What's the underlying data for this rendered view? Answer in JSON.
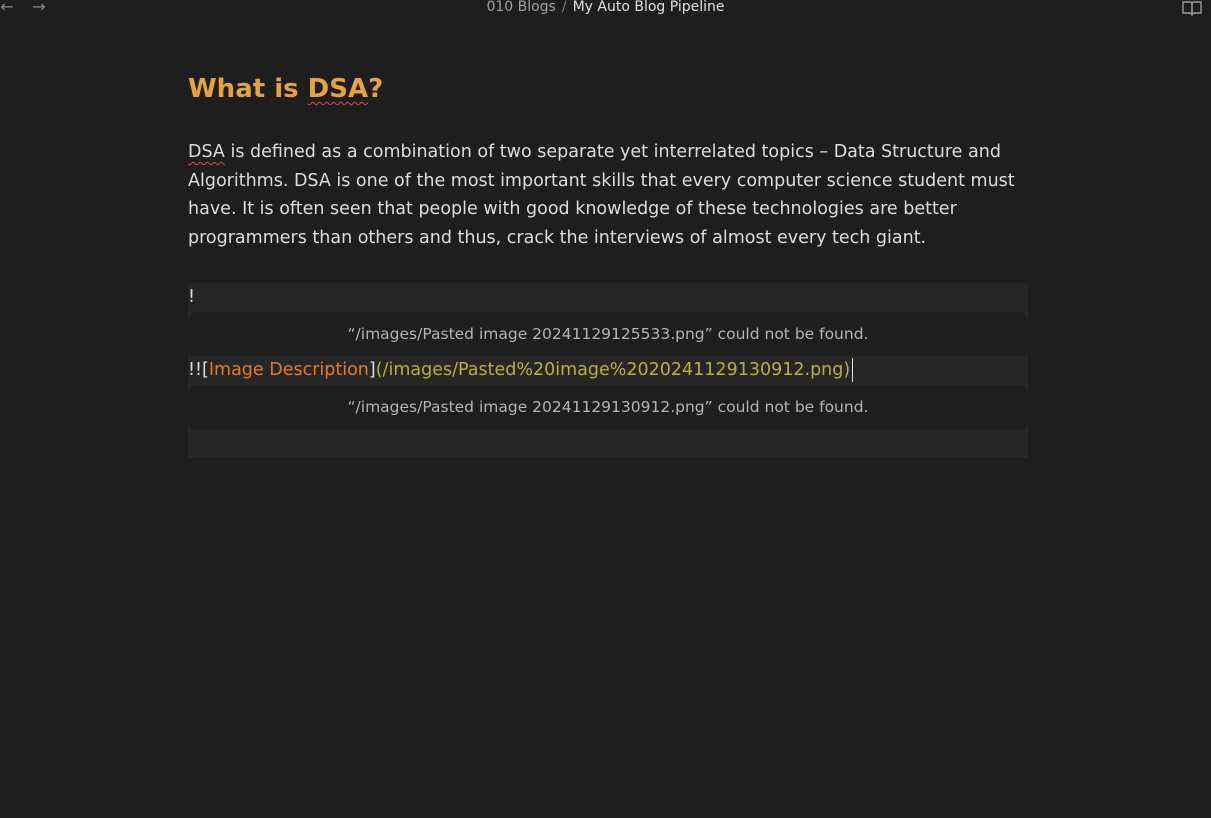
{
  "topbar": {
    "back_glyph": "←",
    "forward_glyph": "→",
    "breadcrumb_folder": "010 Blogs",
    "breadcrumb_separator": "/",
    "breadcrumb_file": "My Auto Blog Pipeline",
    "reading_mode_icon": "open-book-icon"
  },
  "document": {
    "heading_prefix": "What is ",
    "heading_term": "DSA",
    "heading_suffix": "?",
    "paragraph_term": "DSA",
    "paragraph_rest": " is defined as a combination of two separate yet interrelated topics – Data Structure and Algorithms. DSA is one of the most important skills that every computer science student must have. It is often seen that people with good knowledge of these technologies are better programmers than others and thus, crack the interviews of almost every tech giant.",
    "line1_text": "!",
    "embed1_message": "“/images/Pasted image 20241129125533.png” could not be found.",
    "line2_prefix": "!![",
    "line2_alt": "Image Description",
    "line2_close": "]",
    "line2_url": "(/images/Pasted%20image%2020241129130912.png)",
    "embed2_message": "“/images/Pasted image 20241129130912.png” could not be found."
  },
  "colors": {
    "background": "#1e1e1e",
    "heading": "#e6a23c",
    "alt_text": "#e8792b",
    "url_text": "#b5b236",
    "spellcheck_underline": "#e5484d"
  }
}
